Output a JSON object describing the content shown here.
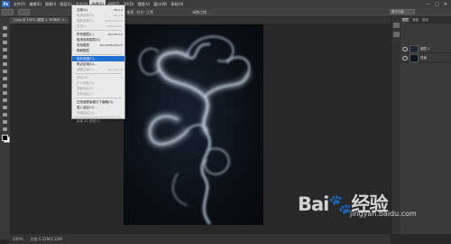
{
  "menubar": {
    "app_icon": "Ps",
    "items": [
      "文件(F)",
      "编辑(E)",
      "图像(I)",
      "图层(L)",
      "文字(Y)",
      "选择(S)",
      "滤镜(T)",
      "3D(D)",
      "视图(V)",
      "窗口(W)",
      "帮助(H)"
    ],
    "active_index": 5,
    "window_controls": [
      "—",
      "□",
      "✕"
    ]
  },
  "options": {
    "mode_text": "羽化: 0 像素",
    "style_text": "样式: 正常",
    "refine_text": "调整边缘...",
    "workspace": "基本功能"
  },
  "document": {
    "tab_label": "1.jpg @ 100% (图层 1, RGB/8)",
    "tab_close": "×"
  },
  "status": {
    "zoom": "100%",
    "doc_info": "文档:1.22M/1.22M"
  },
  "layers_panel": {
    "tabs": [
      "图层",
      "通道",
      "路径"
    ],
    "layers": [
      {
        "name": "图层 1"
      },
      {
        "name": "背景"
      }
    ]
  },
  "select_menu": {
    "items": [
      {
        "label": "全部(A)",
        "shortcut": "Ctrl+A",
        "state": "normal"
      },
      {
        "label": "取消选择(D)",
        "shortcut": "Ctrl+D",
        "state": "disabled"
      },
      {
        "label": "重新选择(E)",
        "shortcut": "Shift+Ctrl+D",
        "state": "disabled"
      },
      {
        "label": "反选(I)",
        "shortcut": "Shift+Ctrl+I",
        "state": "disabled"
      },
      {
        "label": "所有图层(L)",
        "shortcut": "Alt+Ctrl+A",
        "state": "normal"
      },
      {
        "label": "取消选择图层(S)",
        "shortcut": "",
        "state": "normal"
      },
      {
        "label": "查找图层",
        "shortcut": "Alt+Shift+Ctrl+F",
        "state": "normal"
      },
      {
        "label": "隔离图层",
        "shortcut": "",
        "state": "normal"
      },
      {
        "label": "色彩范围(C)...",
        "shortcut": "",
        "state": "highlight"
      },
      {
        "label": "焦点区域(U)...",
        "shortcut": "",
        "state": "normal"
      },
      {
        "label": "调整边缘(F)...",
        "shortcut": "Alt+Ctrl+R",
        "state": "disabled"
      },
      {
        "label": "修改(M)",
        "shortcut": "▸",
        "state": "disabled"
      },
      {
        "label": "扩大选取(G)",
        "shortcut": "",
        "state": "disabled"
      },
      {
        "label": "选取相似(R)",
        "shortcut": "",
        "state": "disabled"
      },
      {
        "label": "变换选区(T)",
        "shortcut": "",
        "state": "disabled"
      },
      {
        "label": "在快速蒙版模式下编辑(Q)",
        "shortcut": "",
        "state": "normal"
      },
      {
        "label": "载入选区(O)...",
        "shortcut": "",
        "state": "normal"
      },
      {
        "label": "存储选区(V)...",
        "shortcut": "",
        "state": "disabled"
      },
      {
        "label": "新建 3D 模型(3)",
        "shortcut": "",
        "state": "disabled"
      }
    ]
  },
  "watermark": {
    "brand": "Bai🐾经验",
    "url": "jingyan.baidu.com"
  },
  "colors": {
    "menu_highlight": "#1f6fd0",
    "ui_dark": "#282828",
    "smoke": "#b8c9dc"
  },
  "icons": {
    "eye": "eye-icon",
    "app": "photoshop-icon"
  }
}
